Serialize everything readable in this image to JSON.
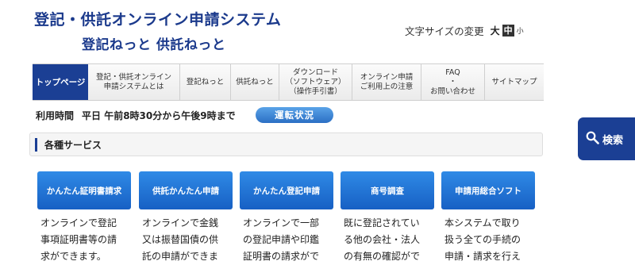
{
  "header": {
    "title_line1": "登記・供託オンライン申請システム",
    "title_line2": "登記ねっと 供託ねっと"
  },
  "font_size_control": {
    "label": "文字サイズの変更",
    "large": "大",
    "medium": "中",
    "small": "小",
    "selected": "中"
  },
  "nav": {
    "items": [
      {
        "label": "トップページ",
        "active": true
      },
      {
        "label": "登記・供託オンライン\n申請システムとは"
      },
      {
        "label": "登記ねっと"
      },
      {
        "label": "供託ねっと"
      },
      {
        "label": "ダウンロード\n（ソフトウェア）\n（操作手引書）"
      },
      {
        "label": "オンライン申請\nご利用上の注意"
      },
      {
        "label": "FAQ\n・\nお問い合わせ"
      },
      {
        "label": "サイトマップ"
      }
    ]
  },
  "hours": {
    "label": "利用時間",
    "value": "平日 午前8時30分から午後9時まで",
    "status_button": "運転状況"
  },
  "services": {
    "title": "各種サービス",
    "items": [
      {
        "label": "かんたん証明書請求",
        "desc": "オンラインで登記\n事項証明書等の請\n求ができます。"
      },
      {
        "label": "供託かんたん申請",
        "desc": "オンラインで金銭\n又は振替国債の供\n託の申請ができま"
      },
      {
        "label": "かんたん登記申請",
        "desc": "オンラインで一部\nの登記申請や印鑑\n証明書の請求がで"
      },
      {
        "label": "商号調査",
        "desc": "既に登記されてい\nる他の会社・法人\nの有無の確認がで"
      },
      {
        "label": "申請用総合ソフト",
        "desc": "本システムで取り\n扱う全ての手続の\n申請・請求を行え"
      }
    ]
  },
  "search": {
    "label": "検索",
    "icon": "search-icon"
  },
  "colors": {
    "brand_navy": "#1b3f94",
    "title_blue": "#1b3a8c",
    "button_blue": "#1f6fd4"
  }
}
